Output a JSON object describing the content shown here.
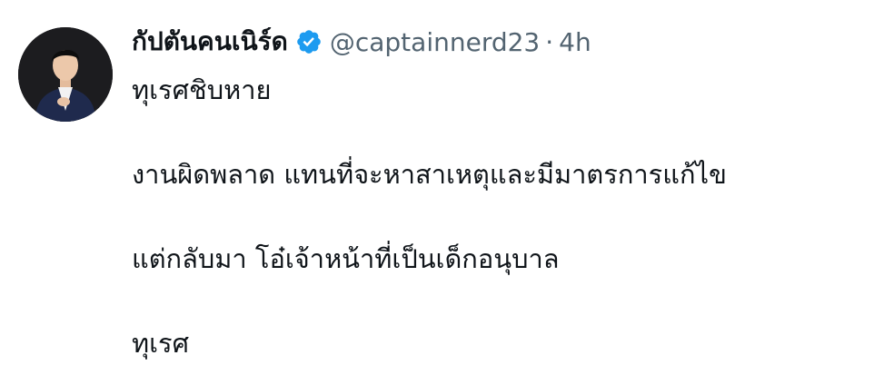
{
  "author": {
    "display_name": "กัปตันคนเนิร์ด",
    "handle": "@captainnerd23",
    "separator": "·",
    "time": "4h",
    "verified_color": "#1d9bf0"
  },
  "tweet": {
    "lines": [
      "ทุเรศชิบหาย",
      "งานผิดพลาด แทนที่จะหาสาเหตุและมีมาตรการแก้ไข",
      "แต่กลับมา โอ๋เจ้าหน้าที่เป็นเด็กอนุบาล",
      "ทุเรศ"
    ]
  }
}
